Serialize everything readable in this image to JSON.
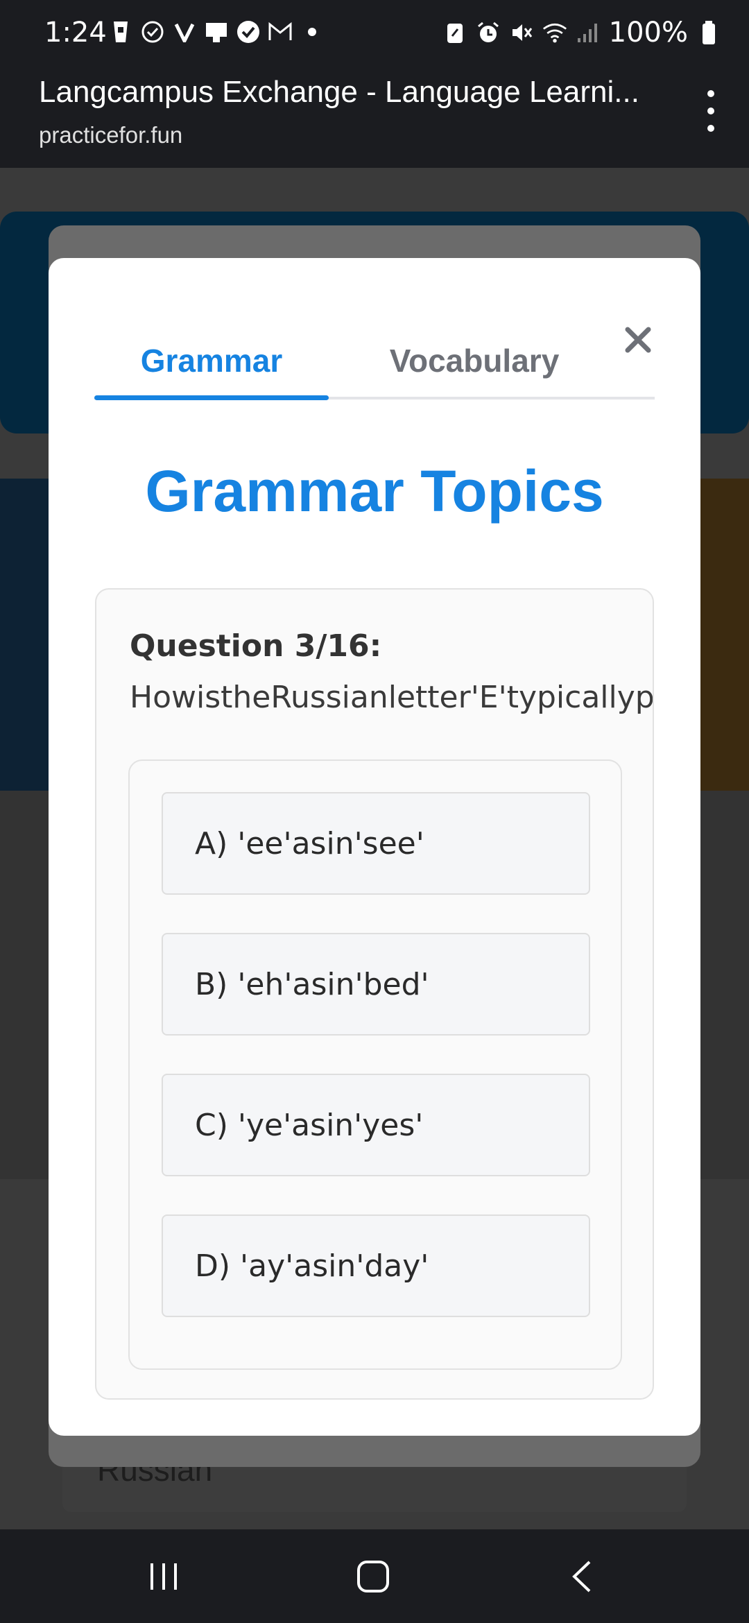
{
  "status_bar": {
    "time": "1:24",
    "battery": "100%"
  },
  "browser": {
    "title": "Langcampus Exchange - Language Learni...",
    "url": "practicefor.fun"
  },
  "background": {
    "select_value": "Russian"
  },
  "modal": {
    "tabs": [
      {
        "label": "Grammar",
        "active": true
      },
      {
        "label": "Vocabulary",
        "active": false
      }
    ],
    "heading": "Grammar Topics",
    "question": {
      "label": "Question 3/16:",
      "text": "HowistheRussianletter'E'typicallypronounced?",
      "options": [
        {
          "label": "A) 'ee'asin'see'"
        },
        {
          "label": "B) 'eh'asin'bed'"
        },
        {
          "label": "C) 'ye'asin'yes'"
        },
        {
          "label": "D) 'ay'asin'day'"
        }
      ]
    }
  },
  "colors": {
    "accent": "#1683e1",
    "inactive_tab": "#6d7077",
    "system_bar": "#1b1c20"
  }
}
